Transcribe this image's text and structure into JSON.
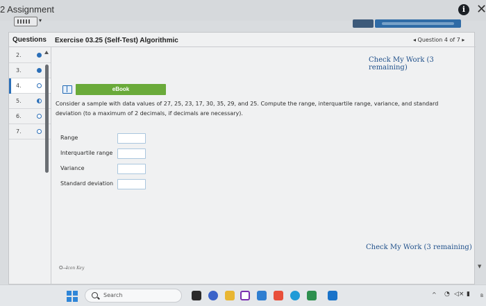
{
  "window": {
    "title": "2 Assignment"
  },
  "header": {
    "questions_label": "Questions",
    "exercise_title": "Exercise 03.25 (Self-Test) Algorithmic",
    "question_nav": "◂ Question 4 of 7 ▸"
  },
  "questions": [
    {
      "num": "2.",
      "status": "done"
    },
    {
      "num": "3.",
      "status": "done"
    },
    {
      "num": "4.",
      "status": "open",
      "current": true
    },
    {
      "num": "5.",
      "status": "partial"
    },
    {
      "num": "6.",
      "status": "open"
    },
    {
      "num": "7.",
      "status": "open"
    }
  ],
  "check_work": {
    "top_label": "Check My Work (3 remaining)",
    "bottom_label": "Check My Work (3 remaining)"
  },
  "ebook": {
    "label": "eBook"
  },
  "question": {
    "text": "Consider a sample with data values of 27, 25, 23, 17, 30, 35, 29, and 25. Compute the range, interquartile range, variance, and standard deviation (to a maximum of 2 decimals, if decimals are necessary)."
  },
  "answers": [
    {
      "label": "Range",
      "value": ""
    },
    {
      "label": "Interquartile range",
      "value": ""
    },
    {
      "label": "Variance",
      "value": ""
    },
    {
      "label": "Standard deviation",
      "value": ""
    }
  ],
  "footer": {
    "icon_key_glyph": "O—",
    "icon_key_label": "Icon Key"
  },
  "taskbar": {
    "search_placeholder": "Search",
    "tray": {
      "caret": "^",
      "wifi": "◔",
      "volume": "◁×",
      "battery": "▮",
      "more": "B"
    }
  },
  "colors": {
    "accent_blue": "#2b6fb8",
    "ebook_green": "#6aaa3a",
    "link_blue": "#1e4f8a",
    "input_border": "#a9c6de"
  }
}
